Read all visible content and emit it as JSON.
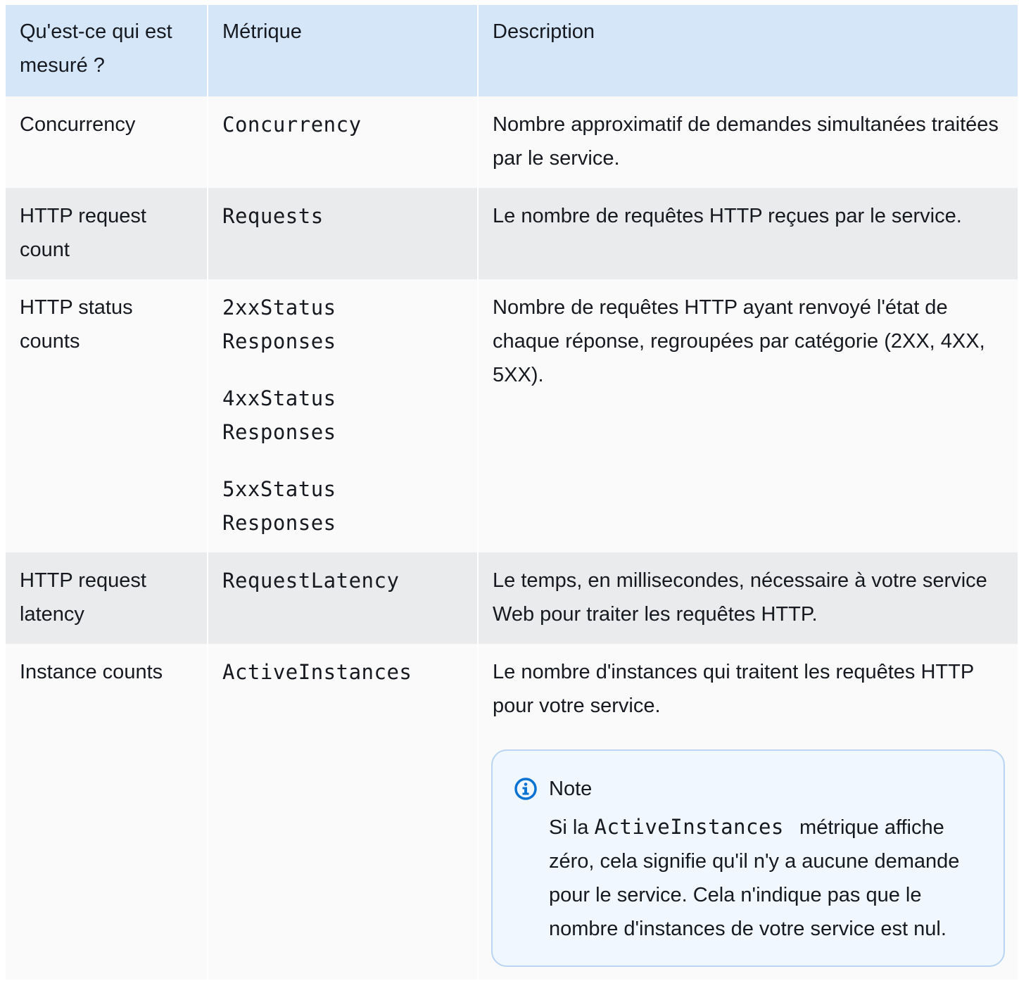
{
  "table": {
    "headers": [
      "Qu'est-ce qui est mesuré ?",
      "Métrique",
      "Description"
    ],
    "rows": [
      {
        "measured": "Concurrency",
        "metrics": [
          "Concurrency"
        ],
        "description": "Nombre approximatif de demandes simultanées traitées par le service."
      },
      {
        "measured": "HTTP request count",
        "metrics": [
          "Requests"
        ],
        "description": "Le nombre de requêtes HTTP reçues par le service."
      },
      {
        "measured": "HTTP status counts",
        "metrics": [
          "2xxStatus Responses",
          "4xxStatus Responses",
          "5xxStatus Responses"
        ],
        "description": "Nombre de requêtes HTTP ayant renvoyé l'état de chaque réponse, regroupées par catégorie (2XX, 4XX, 5XX)."
      },
      {
        "measured": "HTTP request latency",
        "metrics": [
          "RequestLatency"
        ],
        "description": "Le temps, en millisecondes, nécessaire à votre service Web pour traiter les requêtes HTTP."
      },
      {
        "measured": "Instance counts",
        "metrics": [
          "ActiveInstances"
        ],
        "description": "Le nombre d'instances qui traitent les requêtes HTTP pour votre service.",
        "note": {
          "icon": "info-icon",
          "title": "Note",
          "text_before": "Si la",
          "code": "ActiveInstances",
          "text_after": "métrique affiche zéro, cela signifie qu'il n'y a aucune demande pour le service. Cela n'indique pas que le nombre d'instances de votre service est nul."
        }
      }
    ]
  },
  "colors": {
    "header_bg": "#d4e6f8",
    "row_light": "#fafafa",
    "row_dark": "#eaebed",
    "note_bg": "#f0f7fe",
    "note_border": "#b9d5f3",
    "info_icon": "#0972d3"
  }
}
